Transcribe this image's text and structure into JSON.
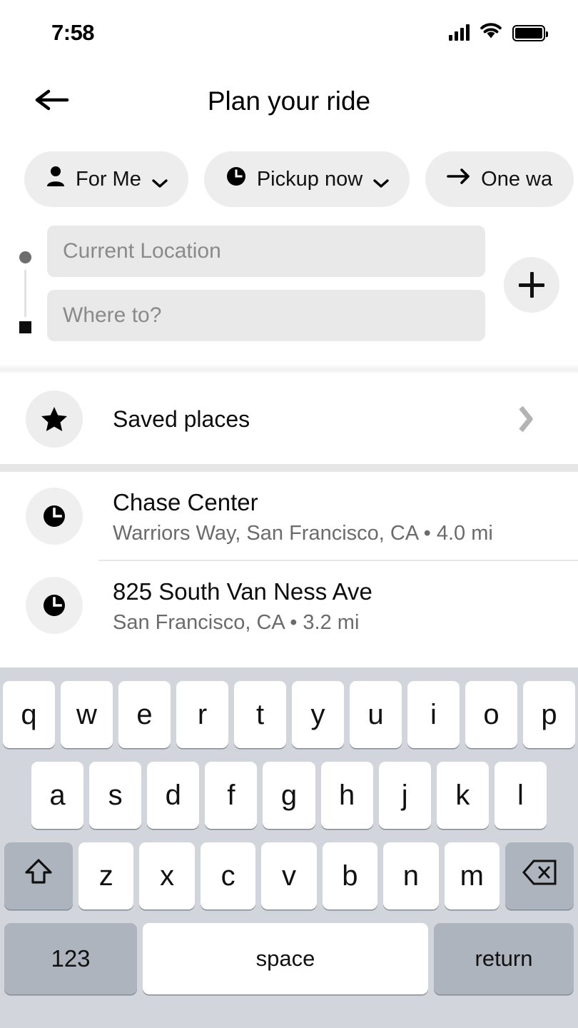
{
  "status_bar": {
    "time": "7:58",
    "cellular_icon": "cellular-signal-icon",
    "wifi_icon": "wifi-icon",
    "battery_icon": "battery-full-icon"
  },
  "header": {
    "back_icon": "back-arrow-icon",
    "title": "Plan your ride"
  },
  "chips": [
    {
      "icon": "person-icon",
      "label": "For Me",
      "trailing_icon": "chevron-down-icon"
    },
    {
      "icon": "clock-icon",
      "label": "Pickup now",
      "trailing_icon": "chevron-down-icon"
    },
    {
      "icon": "arrow-right-icon",
      "label": "One wa",
      "trailing_icon": ""
    }
  ],
  "route": {
    "pickup": {
      "placeholder": "Current Location",
      "value": "",
      "marker": "dot-marker"
    },
    "destination": {
      "placeholder": "Where to?",
      "value": "",
      "marker": "square-marker"
    },
    "add_stop_icon": "plus-icon"
  },
  "saved_places": {
    "icon": "star-icon",
    "label": "Saved places",
    "chevron_icon": "chevron-right-icon"
  },
  "suggestions": [
    {
      "icon": "clock-icon",
      "title": "Chase Center",
      "subtitle": "Warriors Way, San Francisco, CA  •  4.0 mi"
    },
    {
      "icon": "clock-icon",
      "title": "825 South Van Ness Ave",
      "subtitle": "San Francisco, CA  •  3.2 mi"
    }
  ],
  "keyboard": {
    "row1": [
      "q",
      "w",
      "e",
      "r",
      "t",
      "y",
      "u",
      "i",
      "o",
      "p"
    ],
    "row2": [
      "a",
      "s",
      "d",
      "f",
      "g",
      "h",
      "j",
      "k",
      "l"
    ],
    "row3_letters": [
      "z",
      "x",
      "c",
      "v",
      "b",
      "n",
      "m"
    ],
    "shift_icon": "shift-arrow-icon",
    "backspace_icon": "backspace-icon",
    "numbers_label": "123",
    "space_label": "space",
    "return_label": "return"
  },
  "colors": {
    "background": "#ffffff",
    "chip_background": "#ededed",
    "field_background": "#e9e9e9",
    "placeholder_text": "#8a8a8a",
    "primary_text": "#0d0d0d",
    "secondary_text": "#6b6b6b",
    "keyboard_background": "#d2d6dc",
    "key_white": "#ffffff",
    "key_modifier": "#aeb4bd",
    "separator": "#e6e6e6"
  }
}
